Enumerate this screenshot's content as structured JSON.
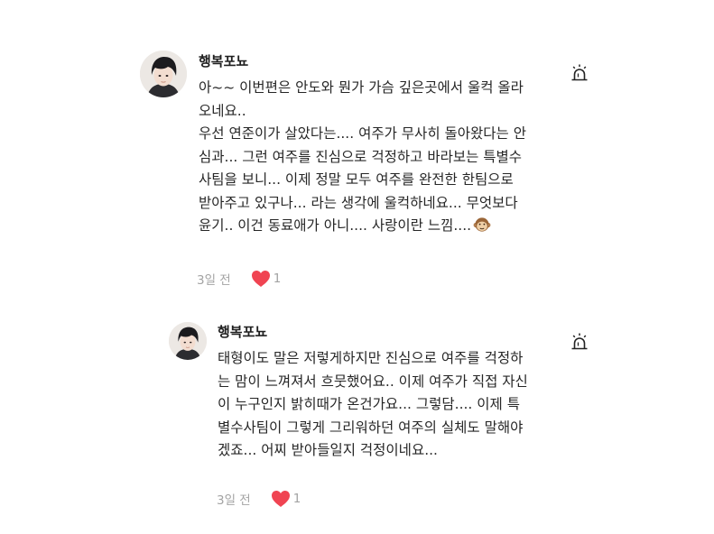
{
  "comments": [
    {
      "username": "행복포뇨",
      "lines": [
        "아~~ 이번편은 안도와 뭔가 가슴 깊은곳에서 울컥 올라",
        "오네요..",
        "우선 연준이가 살았다는.... 여주가 무사히 돌아왔다는 안",
        "심과...  그런 여주를 진심으로 걱정하고 바라보는 특별수",
        "사팀을 보니... 이제 정말 모두 여주를 완전한 한팀으로",
        "받아주고 있구나...  라는 생각에 울컥하네요... 무엇보다",
        "윤기.. 이건 동료애가 아니.... 사랑이란 느낌...."
      ],
      "emoji_icon": "monkey-face-emoji",
      "date": "3일 전",
      "likes": "1",
      "like_color": "#f04452",
      "report_icon": "siren-icon"
    },
    {
      "username": "행복포뇨",
      "lines": [
        "태형이도 말은 저렇게하지만 진심으로 여주를 걱정하",
        "는 맘이 느껴져서 흐뭇했어요.. 이제 여주가 직접 자신",
        "이 누구인지 밝히때가 온건가요... 그렇담.... 이제 특",
        "별수사팀이 그렇게 그리워하던 여주의 실체도 말해야",
        "겠죠... 어찌 받아들일지 걱정이네요..."
      ],
      "date": "3일 전",
      "likes": "1",
      "like_color": "#f04452",
      "report_icon": "siren-icon"
    }
  ]
}
